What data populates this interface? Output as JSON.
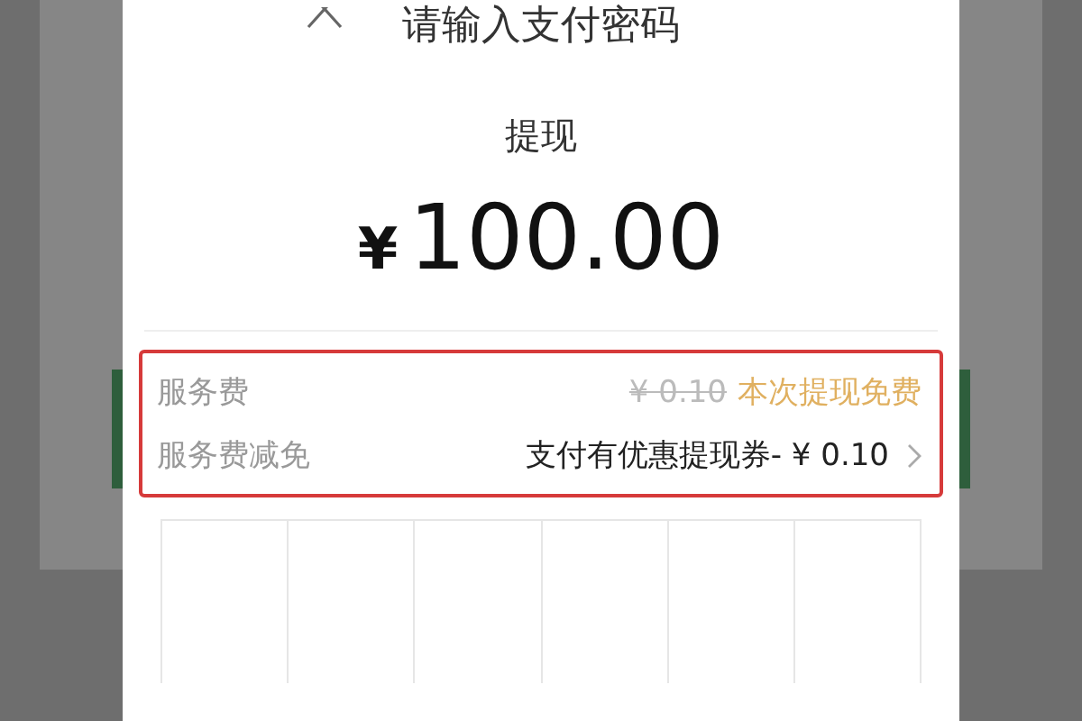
{
  "dialog": {
    "title": "请输入支付密码",
    "purpose": "提现",
    "currency": "¥",
    "amount": "100.00",
    "fees": [
      {
        "kind": "fee",
        "label": "服务费",
        "original": "¥ 0.10",
        "note": "本次提现免费"
      },
      {
        "kind": "discount",
        "label": "服务费减免",
        "value": "支付有优惠提现券- ¥ 0.10"
      }
    ]
  }
}
